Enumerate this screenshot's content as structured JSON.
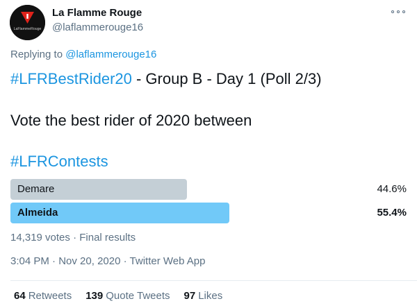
{
  "author": {
    "display_name": "La Flamme Rouge",
    "handle": "@laflammerouge16",
    "avatar_text": "LaFlammeRouge",
    "avatar_colors": {
      "background": "#111111",
      "flag": "#e0231b",
      "mark": "#ffffff"
    }
  },
  "reply": {
    "prefix": "Replying to",
    "to": "@laflammerouge16"
  },
  "body": {
    "line1_hashtag": "#LFRBestRider20",
    "line1_rest": " - Group B - Day 1 (Poll 2/3)",
    "line2": "Vote the best rider of 2020 between",
    "line3_hashtag": "#LFRContests"
  },
  "poll": {
    "options": [
      {
        "label": "Demare",
        "percent_text": "44.6%",
        "percent": 44.6,
        "winner": false
      },
      {
        "label": "Almeida",
        "percent_text": "55.4%",
        "percent": 55.4,
        "winner": true
      }
    ],
    "votes": "14,319 votes",
    "separator": "·",
    "status": "Final results"
  },
  "meta": {
    "time": "3:04 PM",
    "separator": "·",
    "date": "Nov 20, 2020",
    "source": "Twitter Web App"
  },
  "stats": {
    "retweets_count": "64",
    "retweets_label": "Retweets",
    "quote_count": "139",
    "quote_label": "Quote Tweets",
    "likes_count": "97",
    "likes_label": "Likes"
  },
  "colors": {
    "accent": "#1b95e0",
    "muted": "#5b7083",
    "poll_loser": "#c4cfd6",
    "poll_winner": "#71c9f8"
  }
}
